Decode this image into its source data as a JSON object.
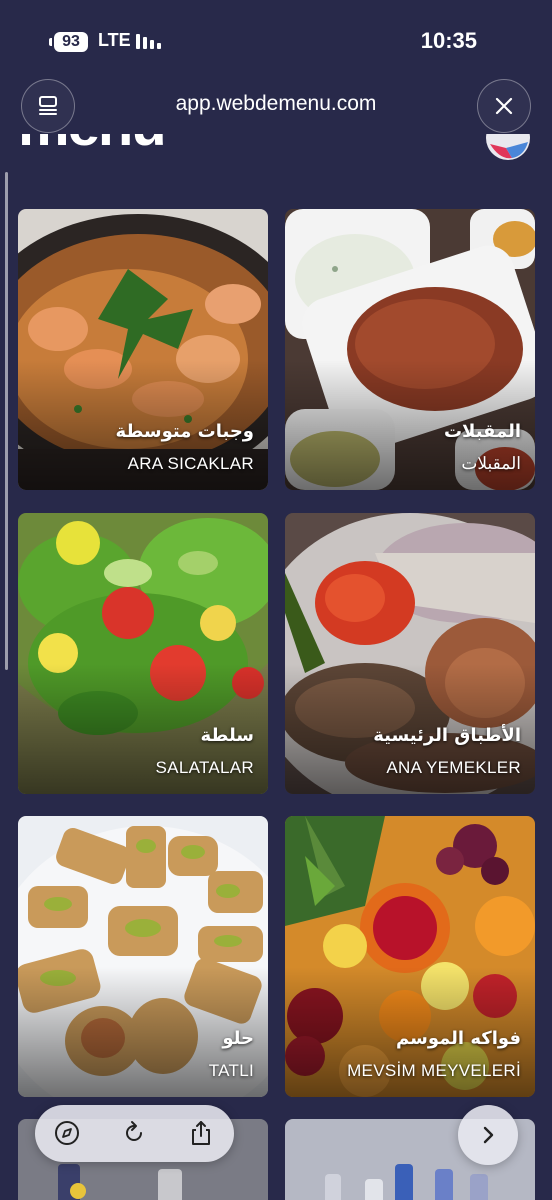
{
  "status_bar": {
    "battery": "93",
    "network": "LTE",
    "time": "10:35"
  },
  "browser": {
    "url": "app.webdemenu.com",
    "tabs_icon": "tabs-icon",
    "close_icon": "close-icon"
  },
  "header": {
    "logo_text": "menu"
  },
  "categories": [
    {
      "title_ar": "وجبات متوسطة",
      "title_tr": "ARA SICAKLAR",
      "image": "shrimp-dish"
    },
    {
      "title_ar": "المقبلات",
      "title_tr": "المقبلات",
      "image": "meze-bowls"
    },
    {
      "title_ar": "سلطة",
      "title_tr": "SALATALAR",
      "image": "salad"
    },
    {
      "title_ar": "الأطباق الرئيسية",
      "title_tr": "ANA YEMEKLER",
      "image": "grilled-meat"
    },
    {
      "title_ar": "حلو",
      "title_tr": "TATLI",
      "image": "baklava"
    },
    {
      "title_ar": "فواكه الموسم",
      "title_tr": "MEVSİM MEYVELERİ",
      "image": "fruit-platter"
    }
  ],
  "bottom_toolbar": {
    "icons": [
      "compass-icon",
      "reload-icon",
      "share-icon"
    ],
    "forward_icon": "chevron-right-icon"
  },
  "colors": {
    "background": "#28294a",
    "toolbar": "#e8e8f0"
  }
}
